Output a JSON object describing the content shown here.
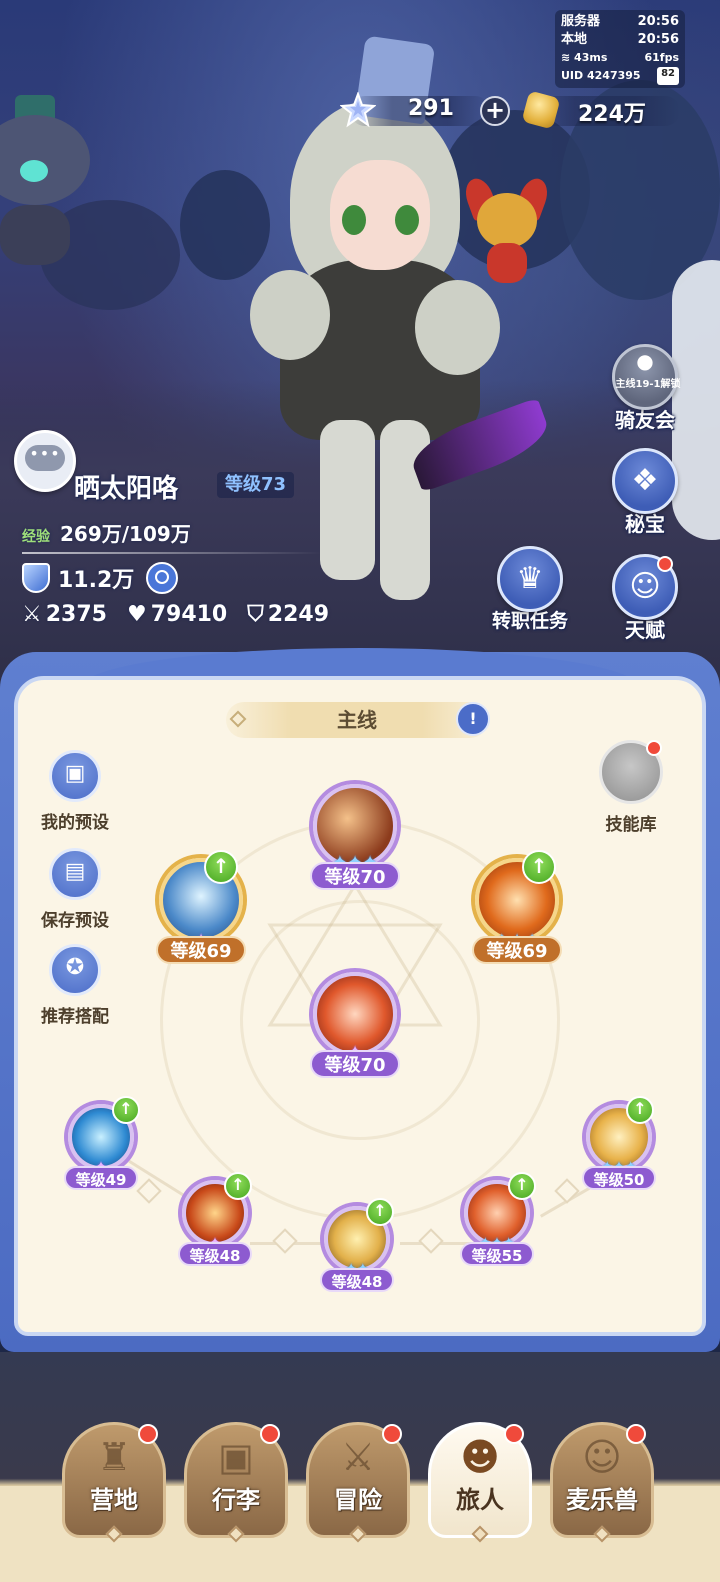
{
  "hud": {
    "server_label": "服务器",
    "server_time": "20:56",
    "local_label": "本地",
    "local_time": "20:56",
    "ping": "43ms",
    "fps": "61fps",
    "uid": "UID 4247395",
    "battery": "82"
  },
  "currency": {
    "stars": "291",
    "add": "+",
    "coins": "224万"
  },
  "side_buttons": {
    "mount_club_lock": "主线19-1解锁",
    "mount_club": "骑友会",
    "treasure": "秘宝",
    "job_change": "转职任务",
    "talent": "天赋"
  },
  "player": {
    "name": "晒太阳咯",
    "level": "等级73",
    "exp_label": "经验",
    "exp_value": "269万/109万",
    "power": "11.2万",
    "attack": "2375",
    "hp": "79410",
    "defense": "2249"
  },
  "panel": {
    "title": "主线",
    "book_icon": "!",
    "my_preset": "我的预设",
    "save_preset": "保存预设",
    "recommend": "推荐搭配",
    "skill_library": "技能库"
  },
  "skills": {
    "top": "等级70",
    "left": "等级69",
    "right": "等级69",
    "center": "等级70",
    "b1": "等级49",
    "b2": "等级48",
    "b3": "等级48",
    "b4": "等级55",
    "b5": "等级50"
  },
  "nav": {
    "camp": "营地",
    "luggage": "行李",
    "adventure": "冒险",
    "traveler": "旅人",
    "pets": "麦乐兽"
  },
  "colors": {
    "panel_blue": "#5f7fd0",
    "panel_cream": "#fbf5e6",
    "level_purple": "#8d5bd0",
    "level_orange": "#c0702a",
    "upgrade_green": "#45a61f",
    "notify_red": "#f04a3b"
  }
}
